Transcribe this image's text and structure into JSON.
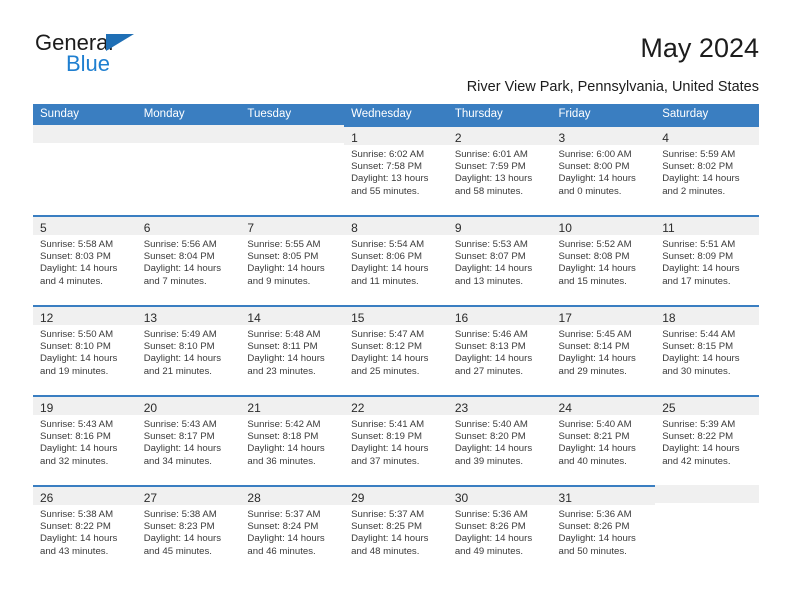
{
  "brand": {
    "name_top": "General",
    "name_bottom": "Blue",
    "triangle_icon": "triangle-icon",
    "accent_color": "#1f7fd0",
    "header_color": "#3a7ec1"
  },
  "header": {
    "title": "May 2024",
    "location": "River View Park, Pennsylvania, United States"
  },
  "weekdays": [
    "Sunday",
    "Monday",
    "Tuesday",
    "Wednesday",
    "Thursday",
    "Friday",
    "Saturday"
  ],
  "labels": {
    "sunrise": "Sunrise:",
    "sunset": "Sunset:",
    "daylight": "Daylight:"
  },
  "weeks": [
    [
      {
        "empty": true
      },
      {
        "empty": true
      },
      {
        "empty": true
      },
      {
        "day": "1",
        "sunrise": "Sunrise: 6:02 AM",
        "sunset": "Sunset: 7:58 PM",
        "daylight1": "Daylight: 13 hours",
        "daylight2": "and 55 minutes."
      },
      {
        "day": "2",
        "sunrise": "Sunrise: 6:01 AM",
        "sunset": "Sunset: 7:59 PM",
        "daylight1": "Daylight: 13 hours",
        "daylight2": "and 58 minutes."
      },
      {
        "day": "3",
        "sunrise": "Sunrise: 6:00 AM",
        "sunset": "Sunset: 8:00 PM",
        "daylight1": "Daylight: 14 hours",
        "daylight2": "and 0 minutes."
      },
      {
        "day": "4",
        "sunrise": "Sunrise: 5:59 AM",
        "sunset": "Sunset: 8:02 PM",
        "daylight1": "Daylight: 14 hours",
        "daylight2": "and 2 minutes."
      }
    ],
    [
      {
        "day": "5",
        "sunrise": "Sunrise: 5:58 AM",
        "sunset": "Sunset: 8:03 PM",
        "daylight1": "Daylight: 14 hours",
        "daylight2": "and 4 minutes."
      },
      {
        "day": "6",
        "sunrise": "Sunrise: 5:56 AM",
        "sunset": "Sunset: 8:04 PM",
        "daylight1": "Daylight: 14 hours",
        "daylight2": "and 7 minutes."
      },
      {
        "day": "7",
        "sunrise": "Sunrise: 5:55 AM",
        "sunset": "Sunset: 8:05 PM",
        "daylight1": "Daylight: 14 hours",
        "daylight2": "and 9 minutes."
      },
      {
        "day": "8",
        "sunrise": "Sunrise: 5:54 AM",
        "sunset": "Sunset: 8:06 PM",
        "daylight1": "Daylight: 14 hours",
        "daylight2": "and 11 minutes."
      },
      {
        "day": "9",
        "sunrise": "Sunrise: 5:53 AM",
        "sunset": "Sunset: 8:07 PM",
        "daylight1": "Daylight: 14 hours",
        "daylight2": "and 13 minutes."
      },
      {
        "day": "10",
        "sunrise": "Sunrise: 5:52 AM",
        "sunset": "Sunset: 8:08 PM",
        "daylight1": "Daylight: 14 hours",
        "daylight2": "and 15 minutes."
      },
      {
        "day": "11",
        "sunrise": "Sunrise: 5:51 AM",
        "sunset": "Sunset: 8:09 PM",
        "daylight1": "Daylight: 14 hours",
        "daylight2": "and 17 minutes."
      }
    ],
    [
      {
        "day": "12",
        "sunrise": "Sunrise: 5:50 AM",
        "sunset": "Sunset: 8:10 PM",
        "daylight1": "Daylight: 14 hours",
        "daylight2": "and 19 minutes."
      },
      {
        "day": "13",
        "sunrise": "Sunrise: 5:49 AM",
        "sunset": "Sunset: 8:10 PM",
        "daylight1": "Daylight: 14 hours",
        "daylight2": "and 21 minutes."
      },
      {
        "day": "14",
        "sunrise": "Sunrise: 5:48 AM",
        "sunset": "Sunset: 8:11 PM",
        "daylight1": "Daylight: 14 hours",
        "daylight2": "and 23 minutes."
      },
      {
        "day": "15",
        "sunrise": "Sunrise: 5:47 AM",
        "sunset": "Sunset: 8:12 PM",
        "daylight1": "Daylight: 14 hours",
        "daylight2": "and 25 minutes."
      },
      {
        "day": "16",
        "sunrise": "Sunrise: 5:46 AM",
        "sunset": "Sunset: 8:13 PM",
        "daylight1": "Daylight: 14 hours",
        "daylight2": "and 27 minutes."
      },
      {
        "day": "17",
        "sunrise": "Sunrise: 5:45 AM",
        "sunset": "Sunset: 8:14 PM",
        "daylight1": "Daylight: 14 hours",
        "daylight2": "and 29 minutes."
      },
      {
        "day": "18",
        "sunrise": "Sunrise: 5:44 AM",
        "sunset": "Sunset: 8:15 PM",
        "daylight1": "Daylight: 14 hours",
        "daylight2": "and 30 minutes."
      }
    ],
    [
      {
        "day": "19",
        "sunrise": "Sunrise: 5:43 AM",
        "sunset": "Sunset: 8:16 PM",
        "daylight1": "Daylight: 14 hours",
        "daylight2": "and 32 minutes."
      },
      {
        "day": "20",
        "sunrise": "Sunrise: 5:43 AM",
        "sunset": "Sunset: 8:17 PM",
        "daylight1": "Daylight: 14 hours",
        "daylight2": "and 34 minutes."
      },
      {
        "day": "21",
        "sunrise": "Sunrise: 5:42 AM",
        "sunset": "Sunset: 8:18 PM",
        "daylight1": "Daylight: 14 hours",
        "daylight2": "and 36 minutes."
      },
      {
        "day": "22",
        "sunrise": "Sunrise: 5:41 AM",
        "sunset": "Sunset: 8:19 PM",
        "daylight1": "Daylight: 14 hours",
        "daylight2": "and 37 minutes."
      },
      {
        "day": "23",
        "sunrise": "Sunrise: 5:40 AM",
        "sunset": "Sunset: 8:20 PM",
        "daylight1": "Daylight: 14 hours",
        "daylight2": "and 39 minutes."
      },
      {
        "day": "24",
        "sunrise": "Sunrise: 5:40 AM",
        "sunset": "Sunset: 8:21 PM",
        "daylight1": "Daylight: 14 hours",
        "daylight2": "and 40 minutes."
      },
      {
        "day": "25",
        "sunrise": "Sunrise: 5:39 AM",
        "sunset": "Sunset: 8:22 PM",
        "daylight1": "Daylight: 14 hours",
        "daylight2": "and 42 minutes."
      }
    ],
    [
      {
        "day": "26",
        "sunrise": "Sunrise: 5:38 AM",
        "sunset": "Sunset: 8:22 PM",
        "daylight1": "Daylight: 14 hours",
        "daylight2": "and 43 minutes."
      },
      {
        "day": "27",
        "sunrise": "Sunrise: 5:38 AM",
        "sunset": "Sunset: 8:23 PM",
        "daylight1": "Daylight: 14 hours",
        "daylight2": "and 45 minutes."
      },
      {
        "day": "28",
        "sunrise": "Sunrise: 5:37 AM",
        "sunset": "Sunset: 8:24 PM",
        "daylight1": "Daylight: 14 hours",
        "daylight2": "and 46 minutes."
      },
      {
        "day": "29",
        "sunrise": "Sunrise: 5:37 AM",
        "sunset": "Sunset: 8:25 PM",
        "daylight1": "Daylight: 14 hours",
        "daylight2": "and 48 minutes."
      },
      {
        "day": "30",
        "sunrise": "Sunrise: 5:36 AM",
        "sunset": "Sunset: 8:26 PM",
        "daylight1": "Daylight: 14 hours",
        "daylight2": "and 49 minutes."
      },
      {
        "day": "31",
        "sunrise": "Sunrise: 5:36 AM",
        "sunset": "Sunset: 8:26 PM",
        "daylight1": "Daylight: 14 hours",
        "daylight2": "and 50 minutes."
      },
      {
        "empty": true
      }
    ]
  ]
}
